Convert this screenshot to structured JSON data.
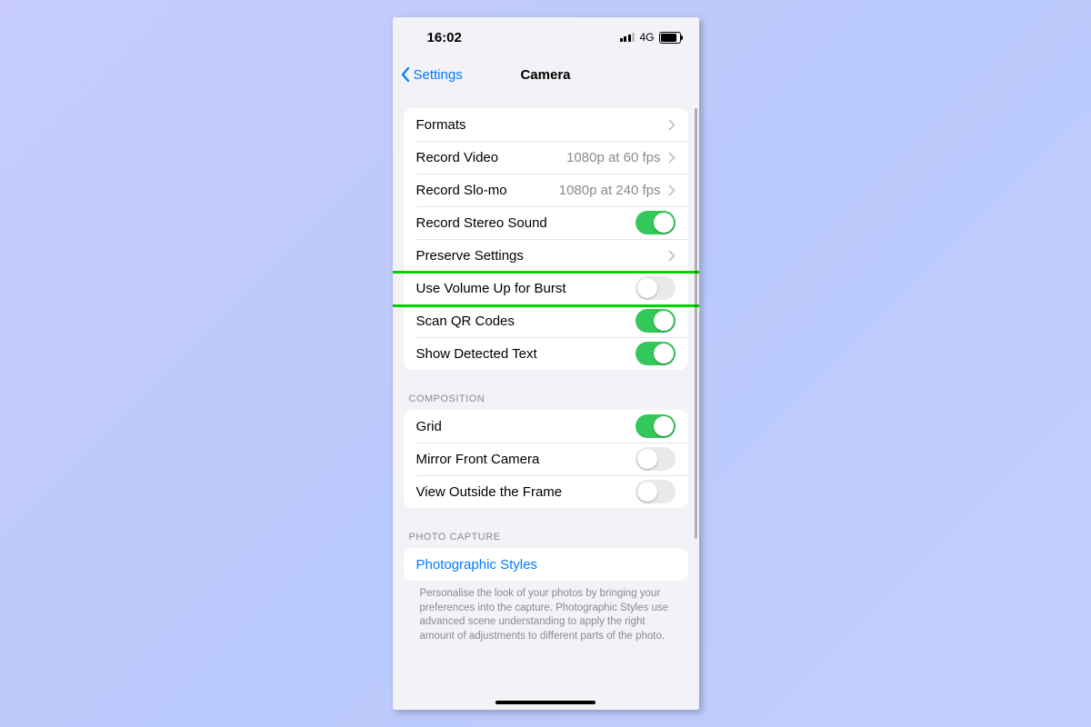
{
  "statusbar": {
    "time": "16:02",
    "network": "4G"
  },
  "nav": {
    "back": "Settings",
    "title": "Camera"
  },
  "group1": {
    "formats": "Formats",
    "record_video_label": "Record Video",
    "record_video_value": "1080p at 60 fps",
    "record_slomo_label": "Record Slo-mo",
    "record_slomo_value": "1080p at 240 fps",
    "stereo_label": "Record Stereo Sound",
    "stereo_on": true,
    "preserve_label": "Preserve Settings",
    "volume_burst_label": "Use Volume Up for Burst",
    "volume_burst_on": false,
    "scan_qr_label": "Scan QR Codes",
    "scan_qr_on": true,
    "detected_text_label": "Show Detected Text",
    "detected_text_on": true
  },
  "group2_header": "COMPOSITION",
  "group2": {
    "grid_label": "Grid",
    "grid_on": true,
    "mirror_label": "Mirror Front Camera",
    "mirror_on": false,
    "view_outside_label": "View Outside the Frame",
    "view_outside_on": false
  },
  "group3_header": "PHOTO CAPTURE",
  "group3": {
    "styles_label": "Photographic Styles",
    "footer_text": "Personalise the look of your photos by bringing your preferences into the capture. Photographic Styles use advanced scene understanding to apply the right amount of adjustments to different parts of the photo."
  }
}
